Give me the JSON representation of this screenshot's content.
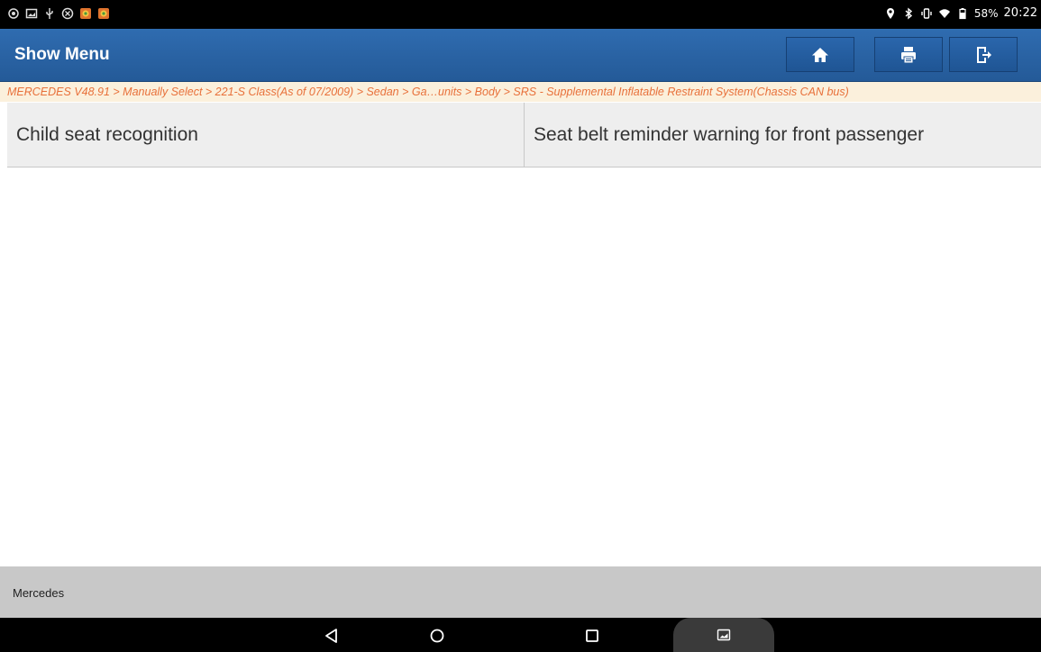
{
  "status_bar": {
    "left_icons": [
      "camera-icon",
      "gallery-icon",
      "usb-icon",
      "settings-icon",
      "app-icon",
      "app-icon"
    ],
    "right_icons": [
      "location-icon",
      "bluetooth-icon",
      "vibrate-icon",
      "wifi-icon",
      "battery-icon"
    ],
    "battery": "58%",
    "time": "20:22"
  },
  "header": {
    "title": "Show Menu",
    "buttons": [
      {
        "name": "home",
        "icon": "home-icon"
      },
      {
        "name": "print",
        "icon": "printer-icon"
      },
      {
        "name": "exit",
        "icon": "exit-icon"
      }
    ]
  },
  "breadcrumb": "MERCEDES V48.91 > Manually Select > 221-S Class(As of 07/2009) > Sedan > Ga…units > Body > SRS - Supplemental Inflatable Restraint System(Chassis CAN bus)",
  "menu": {
    "items": [
      {
        "label": "Child seat recognition"
      },
      {
        "label": "Seat belt reminder warning for front passenger"
      }
    ]
  },
  "footer": {
    "label": "Mercedes"
  },
  "colors": {
    "header_blue": "#2a64a8",
    "breadcrumb_text": "#e8703a",
    "breadcrumb_bg": "#fbf0dc",
    "footer_bg": "#c8c8c8"
  }
}
